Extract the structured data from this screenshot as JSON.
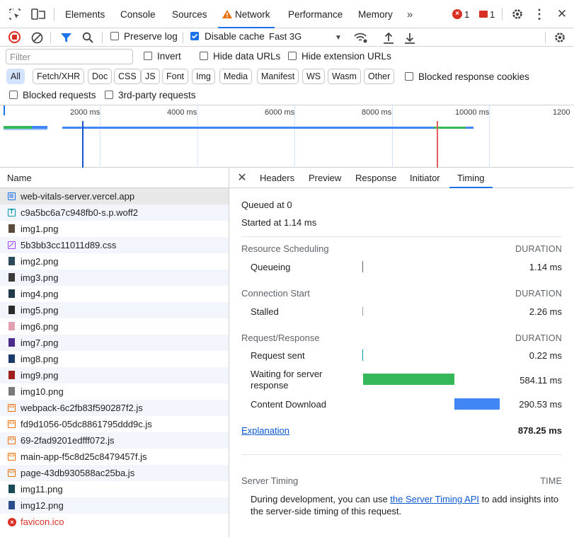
{
  "tabs": {
    "elements": "Elements",
    "console": "Console",
    "sources": "Sources",
    "network": "Network",
    "performance": "Performance",
    "memory": "Memory"
  },
  "badges": {
    "errors": "1",
    "issues": "1"
  },
  "toolbar": {
    "preserve_log": "Preserve log",
    "disable_cache": "Disable cache",
    "throttle": "Fast 3G"
  },
  "filter": {
    "placeholder": "Filter",
    "invert": "Invert",
    "hide_data_urls": "Hide data URLs",
    "hide_extension_urls": "Hide extension URLs",
    "types": [
      "All",
      "Fetch/XHR",
      "Doc",
      "CSS",
      "JS",
      "Font",
      "Img",
      "Media",
      "Manifest",
      "WS",
      "Wasm",
      "Other"
    ],
    "blocked_response_cookies": "Blocked response cookies",
    "blocked_requests": "Blocked requests",
    "third_party": "3rd-party requests"
  },
  "overview": {
    "ticks": [
      "2000 ms",
      "4000 ms",
      "6000 ms",
      "8000 ms",
      "10000 ms",
      "1200"
    ]
  },
  "list": {
    "header": "Name",
    "rows": [
      {
        "name": "web-vitals-server.vercel.app",
        "type": "doc"
      },
      {
        "name": "c9a5bc6a7c948fb0-s.p.woff2",
        "type": "font"
      },
      {
        "name": "img1.png",
        "type": "img"
      },
      {
        "name": "5b3bb3cc11011d89.css",
        "type": "css"
      },
      {
        "name": "img2.png",
        "type": "img"
      },
      {
        "name": "img3.png",
        "type": "img"
      },
      {
        "name": "img4.png",
        "type": "img"
      },
      {
        "name": "img5.png",
        "type": "img"
      },
      {
        "name": "img6.png",
        "type": "img"
      },
      {
        "name": "img7.png",
        "type": "img"
      },
      {
        "name": "img8.png",
        "type": "img"
      },
      {
        "name": "img9.png",
        "type": "img"
      },
      {
        "name": "img10.png",
        "type": "img"
      },
      {
        "name": "webpack-6c2fb83f590287f2.js",
        "type": "js"
      },
      {
        "name": "fd9d1056-05dc8861795ddd9c.js",
        "type": "js"
      },
      {
        "name": "69-2fad9201edfff072.js",
        "type": "js"
      },
      {
        "name": "main-app-f5c8d25c8479457f.js",
        "type": "js"
      },
      {
        "name": "page-43db930588ac25ba.js",
        "type": "js"
      },
      {
        "name": "img11.png",
        "type": "img"
      },
      {
        "name": "img12.png",
        "type": "img"
      },
      {
        "name": "favicon.ico",
        "type": "error"
      }
    ]
  },
  "details": {
    "tabs": [
      "Headers",
      "Preview",
      "Response",
      "Initiator",
      "Timing"
    ],
    "queued": "Queued at 0",
    "started": "Started at 1.14 ms",
    "duration_label": "DURATION",
    "resource_scheduling": "Resource Scheduling",
    "queueing": {
      "label": "Queueing",
      "value": "1.14 ms"
    },
    "connection_start": "Connection Start",
    "stalled": {
      "label": "Stalled",
      "value": "2.26 ms"
    },
    "request_response": "Request/Response",
    "request_sent": {
      "label": "Request sent",
      "value": "0.22 ms"
    },
    "waiting": {
      "label": "Waiting for server response",
      "value": "584.11 ms"
    },
    "content_download": {
      "label": "Content Download",
      "value": "290.53 ms"
    },
    "explanation": "Explanation",
    "total": "878.25 ms",
    "server_timing": "Server Timing",
    "time_label": "TIME",
    "server_text_before": "During development, you can use ",
    "server_link": "the Server Timing API",
    "server_text_after": " to add insights into the server-side timing of this request."
  },
  "colors": {
    "accent": "#1a73e8",
    "waiting": "#34b85a",
    "download": "#4285f4",
    "error": "#d93025"
  }
}
